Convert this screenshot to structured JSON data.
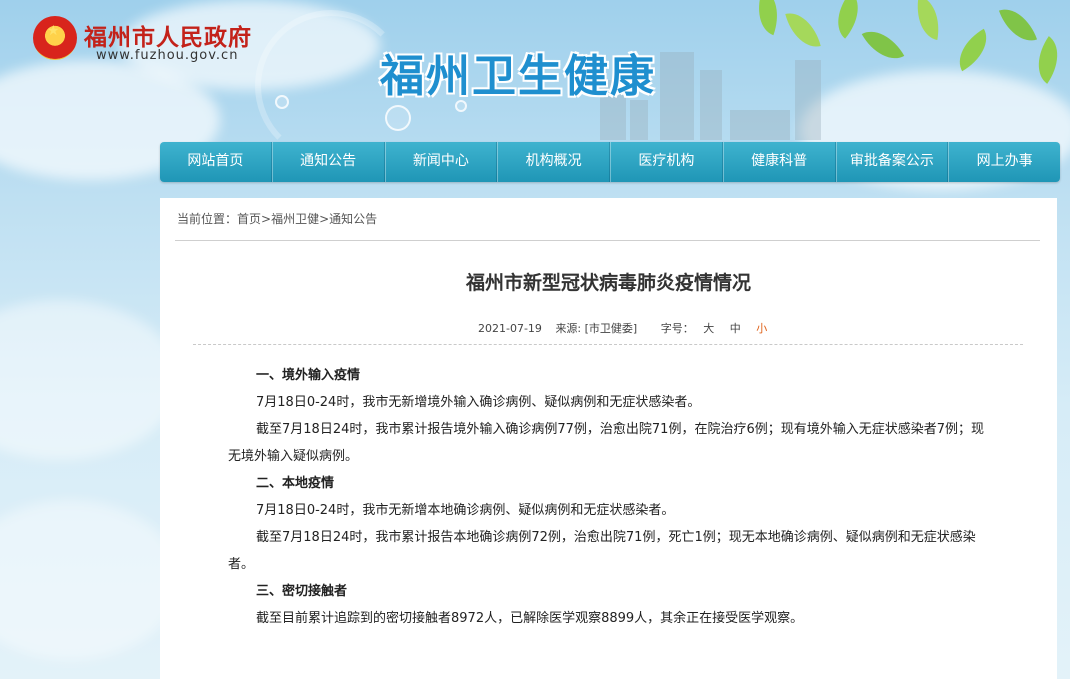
{
  "header": {
    "gov_name": "福州市人民政府",
    "gov_url": "www.fuzhou.gov.cn",
    "site_title": "福州卫生健康"
  },
  "nav": [
    {
      "label": "网站首页"
    },
    {
      "label": "通知公告"
    },
    {
      "label": "新闻中心"
    },
    {
      "label": "机构概况"
    },
    {
      "label": "医疗机构"
    },
    {
      "label": "健康科普"
    },
    {
      "label": "审批备案公示"
    },
    {
      "label": "网上办事"
    }
  ],
  "breadcrumb": {
    "prefix": "当前位置：",
    "items": [
      "首页",
      "福州卫健",
      "通知公告"
    ],
    "separator": ">"
  },
  "article": {
    "title": "福州市新型冠状病毒肺炎疫情情况",
    "date": "2021-07-19",
    "source": "来源: [市卫健委]",
    "font_label": "字号：",
    "font_sizes": [
      "大",
      "中",
      "小"
    ],
    "font_size_selected": "小",
    "sections": [
      {
        "heading": "一、境外输入疫情",
        "paragraphs": [
          "7月18日0-24时，我市无新增境外输入确诊病例、疑似病例和无症状感染者。",
          "截至7月18日24时，我市累计报告境外输入确诊病例77例，治愈出院71例，在院治疗6例；现有境外输入无症状感染者7例；现无境外输入疑似病例。"
        ]
      },
      {
        "heading": "二、本地疫情",
        "paragraphs": [
          "7月18日0-24时，我市无新增本地确诊病例、疑似病例和无症状感染者。",
          "截至7月18日24时，我市累计报告本地确诊病例72例，治愈出院71例，死亡1例；现无本地确诊病例、疑似病例和无症状感染者。"
        ]
      },
      {
        "heading": "三、密切接触者",
        "paragraphs": [
          "截至目前累计追踪到的密切接触者8972人，已解除医学观察8899人，其余正在接受医学观察。"
        ]
      }
    ]
  },
  "colors": {
    "nav_bg": "#1f96b6",
    "gov_red": "#c3221a",
    "title_blue": "#1f8fcf",
    "active_size": "#e0621a"
  }
}
